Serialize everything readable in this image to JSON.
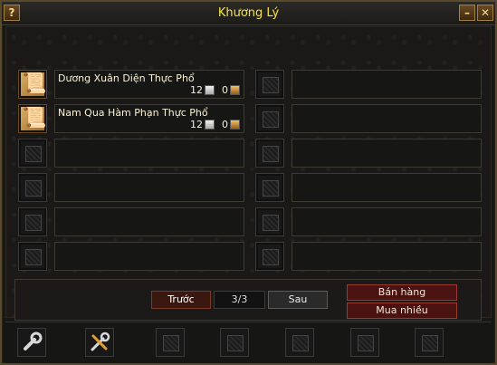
{
  "window": {
    "title": "Khương Lý",
    "help_label": "?",
    "min_label": "–",
    "close_label": "✕"
  },
  "items_left": [
    {
      "name": "Dương Xuân Diện Thực Phổ",
      "silver": "12",
      "gold": "0",
      "icon": "recipe-scroll-icon"
    },
    {
      "name": "Nam Qua Hàm Phạn Thực Phổ",
      "silver": "12",
      "gold": "0",
      "icon": "recipe-scroll-icon"
    }
  ],
  "pager": {
    "prev_label": "Trước",
    "page": "3/3",
    "next_label": "Sau"
  },
  "actions": {
    "sell_label": "Bán hàng",
    "bulk_buy_label": "Mua nhiều"
  },
  "toolbar": {
    "tools": [
      "wrench-icon",
      "wrench-screwdriver-icon"
    ]
  },
  "colors": {
    "title": "#f6e23a",
    "frame": "#5a4a2c",
    "red_button": "#4a1210"
  }
}
